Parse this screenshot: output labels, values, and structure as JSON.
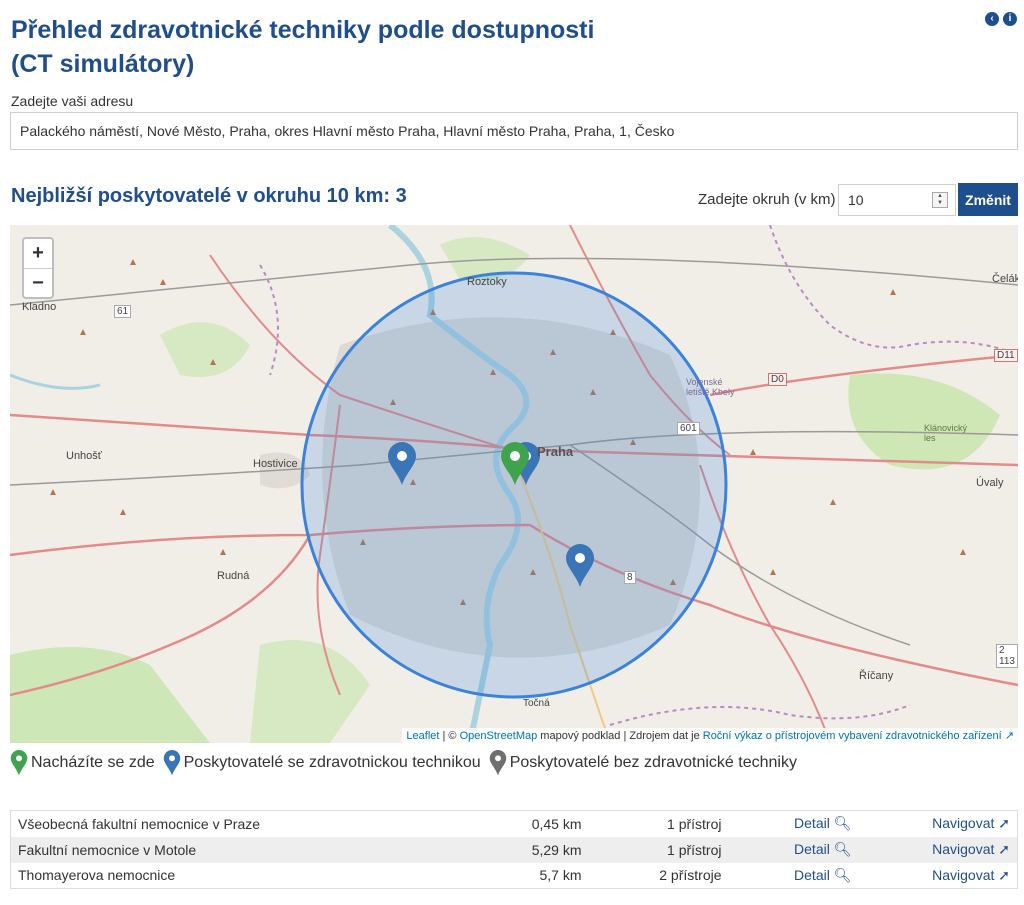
{
  "page": {
    "title_line1": "Přehled zdravotnické techniky podle dostupnosti",
    "title_line2": "(CT simulátory)"
  },
  "header_icons": [
    "back-icon",
    "info-icon"
  ],
  "address": {
    "label": "Zadejte vaši adresu",
    "value": "Palackého náměstí, Nové Město, Praha, okres Hlavní město Praha, Hlavní město Praha, Praha, 1, Česko"
  },
  "nearest_heading": "Nejbližší poskytovatelé v okruhu 10 km: 3",
  "radius": {
    "label": "Zadejte okruh (v km)",
    "value": "10",
    "button": "Změnit"
  },
  "map": {
    "zoom_in": "+",
    "zoom_out": "−",
    "places": {
      "kladno": "Kladno",
      "roztoky": "Roztoky",
      "unhost": "Unhošť",
      "hostivice": "Hostivice",
      "rudna": "Rudná",
      "celak": "Čelák",
      "uvaly": "Úvaly",
      "ricany": "Říčany",
      "vojenske_letiste": "Vojenské letiště Kbely",
      "klanovicky_les": "Klánovický les",
      "tocna": "Točná",
      "praha": "Praha",
      "d11": "D11",
      "d0": "D0",
      "r61": "61",
      "r601": "601",
      "r8": "8",
      "r2_113": "2 113"
    },
    "colors": {
      "user": "#3fa34d",
      "with_tech": "#3a75b8",
      "without_tech": "#6f6f6f",
      "circle": "#3b82d9"
    },
    "attribution": {
      "leaflet": "Leaflet",
      "sep1": " | © ",
      "osm": "OpenStreetMap",
      "text": " mapový podklad | Zdrojem dat je ",
      "source": "Roční výkaz o přístrojovém vybavení zdravotnického zařízení"
    }
  },
  "legend": {
    "here": "Nacházíte se zde",
    "with_tech": "Poskytovatelé se zdravotnickou technikou",
    "without_tech": "Poskytovatelé bez zdravotnické techniky"
  },
  "results": [
    {
      "name": "Všeobecná fakultní nemocnice v Praze",
      "distance": "0,45 km",
      "devices": "1 přístroj",
      "detail": "Detail",
      "navigate": "Navigovat"
    },
    {
      "name": "Fakultní nemocnice v Motole",
      "distance": "5,29 km",
      "devices": "1 přístroj",
      "detail": "Detail",
      "navigate": "Navigovat"
    },
    {
      "name": "Thomayerova nemocnice",
      "distance": "5,7 km",
      "devices": "2 přístroje",
      "detail": "Detail",
      "navigate": "Navigovat"
    }
  ]
}
